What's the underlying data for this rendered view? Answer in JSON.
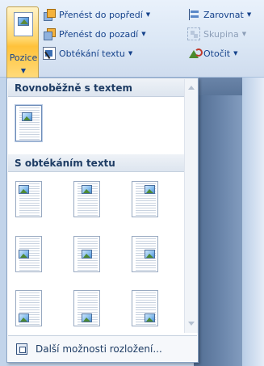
{
  "ribbon": {
    "position_button": {
      "label": "Pozice",
      "icon": "position-icon"
    },
    "items": [
      {
        "id": "bring-forward",
        "label": "Přenést do popředí",
        "icon": "bring-forward-icon",
        "has_dropdown": true,
        "enabled": true
      },
      {
        "id": "send-backward",
        "label": "Přenést do pozadí",
        "icon": "send-backward-icon",
        "has_dropdown": true,
        "enabled": true
      },
      {
        "id": "text-wrapping",
        "label": "Obtékání textu",
        "icon": "text-wrapping-icon",
        "has_dropdown": true,
        "enabled": true
      },
      {
        "id": "align",
        "label": "Zarovnat",
        "icon": "align-icon",
        "has_dropdown": true,
        "enabled": true
      },
      {
        "id": "group",
        "label": "Skupina",
        "icon": "group-icon",
        "has_dropdown": true,
        "enabled": false
      },
      {
        "id": "rotate",
        "label": "Otočit",
        "icon": "rotate-icon",
        "has_dropdown": true,
        "enabled": true
      }
    ]
  },
  "panel": {
    "inline_section": {
      "title": "Rovnoběžně s textem",
      "options": [
        {
          "id": "inline",
          "icon": "inline-with-text-icon"
        }
      ]
    },
    "wrap_section": {
      "title": "S obtékáním textu",
      "options": [
        {
          "id": "top-left",
          "icon": "wrap-top-left-icon"
        },
        {
          "id": "top-center",
          "icon": "wrap-top-center-icon"
        },
        {
          "id": "top-right",
          "icon": "wrap-top-right-icon"
        },
        {
          "id": "middle-left",
          "icon": "wrap-middle-left-icon"
        },
        {
          "id": "middle-center",
          "icon": "wrap-middle-center-icon"
        },
        {
          "id": "middle-right",
          "icon": "wrap-middle-right-icon"
        },
        {
          "id": "bottom-left",
          "icon": "wrap-bottom-left-icon"
        },
        {
          "id": "bottom-center",
          "icon": "wrap-bottom-center-icon"
        },
        {
          "id": "bottom-right",
          "icon": "wrap-bottom-right-icon"
        }
      ]
    },
    "footer": {
      "label": "Další možnosti rozložení...",
      "icon": "layout-options-icon"
    }
  },
  "colors": {
    "ribbon_text": "#15428b",
    "active_button_top": "#fff3c8",
    "active_button_bottom": "#ffc23a",
    "panel_border": "#8aa3c4"
  }
}
